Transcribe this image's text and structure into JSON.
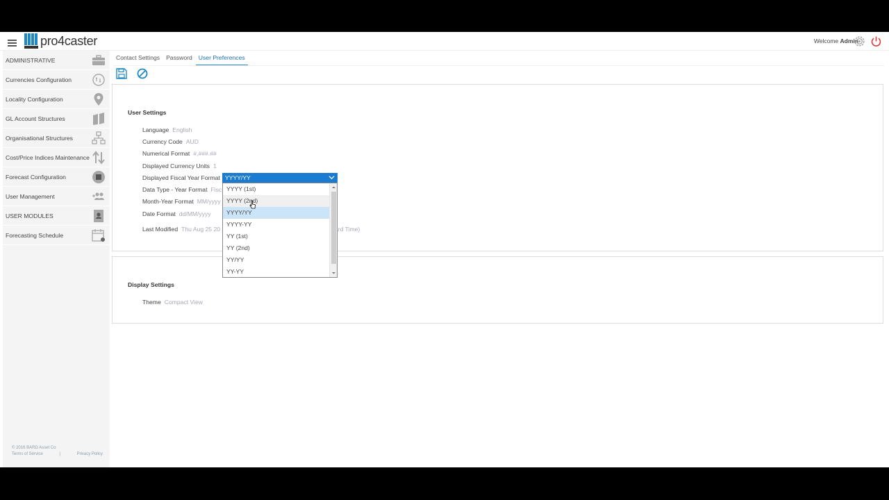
{
  "header": {
    "app_name": "pro4caster",
    "welcome_prefix": "Welcome",
    "user_name": "Admin",
    "icons": {
      "menu": "hamburger-icon",
      "settings": "gear-icon",
      "logout": "power-icon"
    },
    "colors": {
      "brand": "#1e88c7",
      "logout": "#e03030"
    }
  },
  "sidebar": {
    "items": [
      {
        "label": "ADMINISTRATIVE",
        "icon": "briefcase-icon",
        "section": true
      },
      {
        "label": "Currencies Configuration",
        "icon": "currency-exchange-icon"
      },
      {
        "label": "Locality Configuration",
        "icon": "map-pin-icon"
      },
      {
        "label": "GL Account Structures",
        "icon": "book-icon"
      },
      {
        "label": "Organisational Structures",
        "icon": "org-chart-icon"
      },
      {
        "label": "Cost/Price Indices Maintenance",
        "icon": "up-down-arrows-icon"
      },
      {
        "label": "Forecast Configuration",
        "icon": "forecast-icon"
      },
      {
        "label": "User Management",
        "icon": "users-icon"
      },
      {
        "label": "USER MODULES",
        "icon": "contact-card-icon",
        "section": true
      },
      {
        "label": "Forecasting Schedule",
        "icon": "calendar-icon"
      }
    ],
    "footer": {
      "copyright": "© 2016 BARD Asset Co",
      "terms": "Terms of Service",
      "separator": "|",
      "privacy": "Privacy Policy"
    }
  },
  "tabs": [
    {
      "label": "Contact Settings",
      "active": false
    },
    {
      "label": "Password",
      "active": false
    },
    {
      "label": "User Preferences",
      "active": true
    }
  ],
  "toolbar": {
    "save_icon": "save-icon",
    "cancel_icon": "cancel-icon"
  },
  "user_settings": {
    "title": "User Settings",
    "language": {
      "label": "Language",
      "value": "English"
    },
    "currency_code": {
      "label": "Currency Code",
      "value": "AUD"
    },
    "numerical_format": {
      "label": "Numerical Format",
      "value": "#,###.##"
    },
    "currency_units": {
      "label": "Displayed Currency Units",
      "value": "1"
    },
    "fiscal_year_format": {
      "label": "Displayed Fiscal Year Format",
      "value": "YYYY/YY",
      "options": [
        "YYYY (1st)",
        "YYYY (2nd)",
        "YYYY/YY",
        "YYYY-YY",
        "YY (1st)",
        "YY (2nd)",
        "YY/YY",
        "YY-YY"
      ],
      "hovered_option": "YYYY (2nd)"
    },
    "data_type_year_format": {
      "label": "Data Type - Year Format",
      "value": "Fisc"
    },
    "month_year_format": {
      "label": "Month-Year Format",
      "value": "MM/yyyy"
    },
    "date_format": {
      "label": "Date Format",
      "value": "dd/MM/yyyy"
    },
    "last_modified": {
      "label": "Last Modified",
      "value_left": "Thu Aug 25 20",
      "value_right": "ard Time)"
    }
  },
  "display_settings": {
    "title": "Display Settings",
    "theme": {
      "label": "Theme",
      "value": "Compact View"
    }
  }
}
